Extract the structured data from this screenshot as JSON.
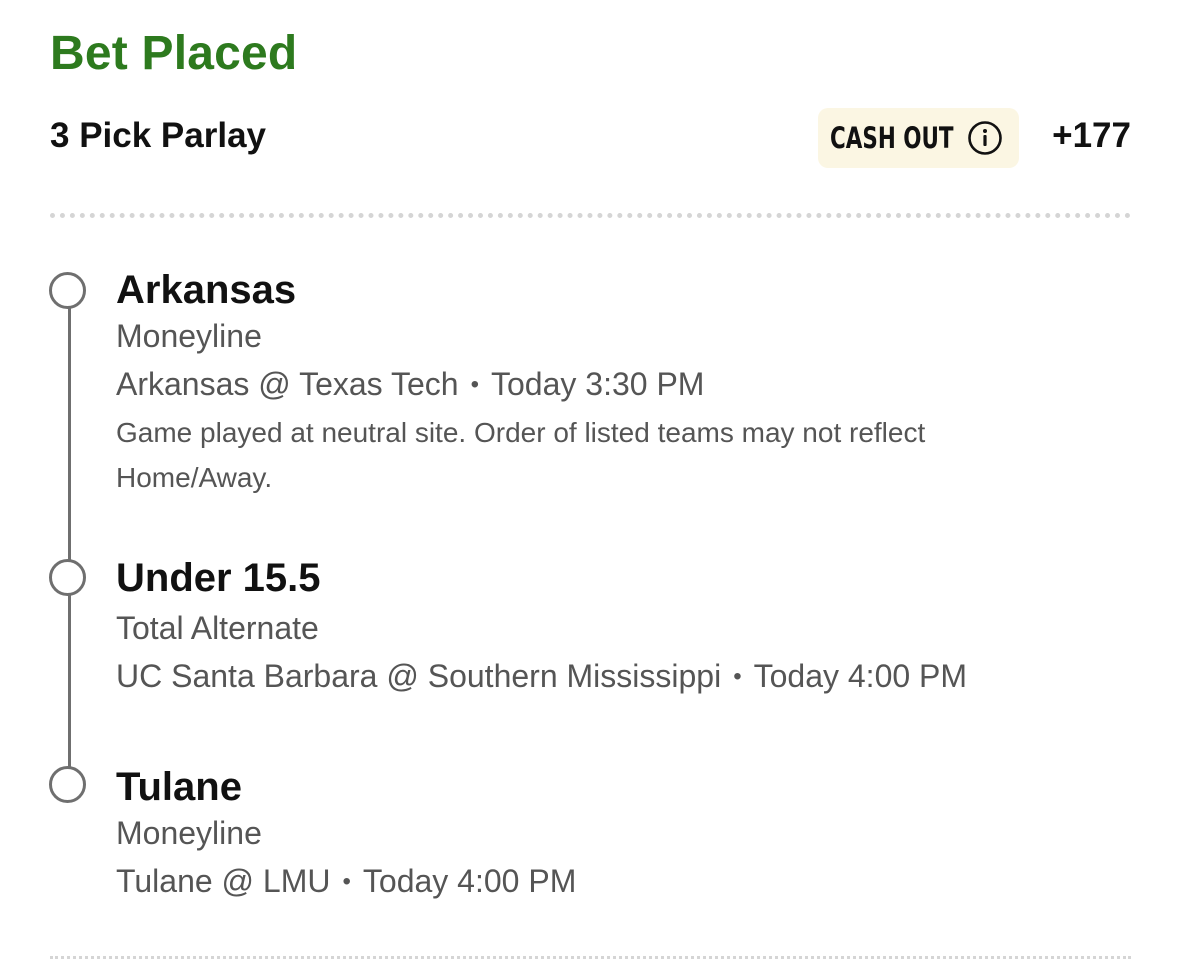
{
  "status_title": "Bet Placed",
  "header": {
    "bet_type": "3 Pick Parlay",
    "cashout_label": "CASH OUT",
    "odds": "+177"
  },
  "legs": [
    {
      "selection": "Arkansas",
      "market": "Moneyline",
      "matchup": "Arkansas @ Texas Tech",
      "time": "Today 3:30 PM",
      "note": "Game played at neutral site. Order of listed teams may not reflect Home/Away."
    },
    {
      "selection": "Under 15.5",
      "market": "Total Alternate",
      "matchup": "UC Santa Barbara @ Southern Mississippi",
      "time": "Today 4:00 PM"
    },
    {
      "selection": "Tulane",
      "market": "Moneyline",
      "matchup": "Tulane @ LMU",
      "time": "Today 4:00 PM"
    }
  ],
  "separator": "•",
  "icons": {
    "cashout_info": "info-circle-icon",
    "leg_marker": "circle-outline-icon"
  },
  "colors": {
    "status_green": "#2d7a1e",
    "cashout_bg": "#fbf6e3",
    "timeline": "#6f6f6f",
    "secondary_text": "#555555"
  }
}
